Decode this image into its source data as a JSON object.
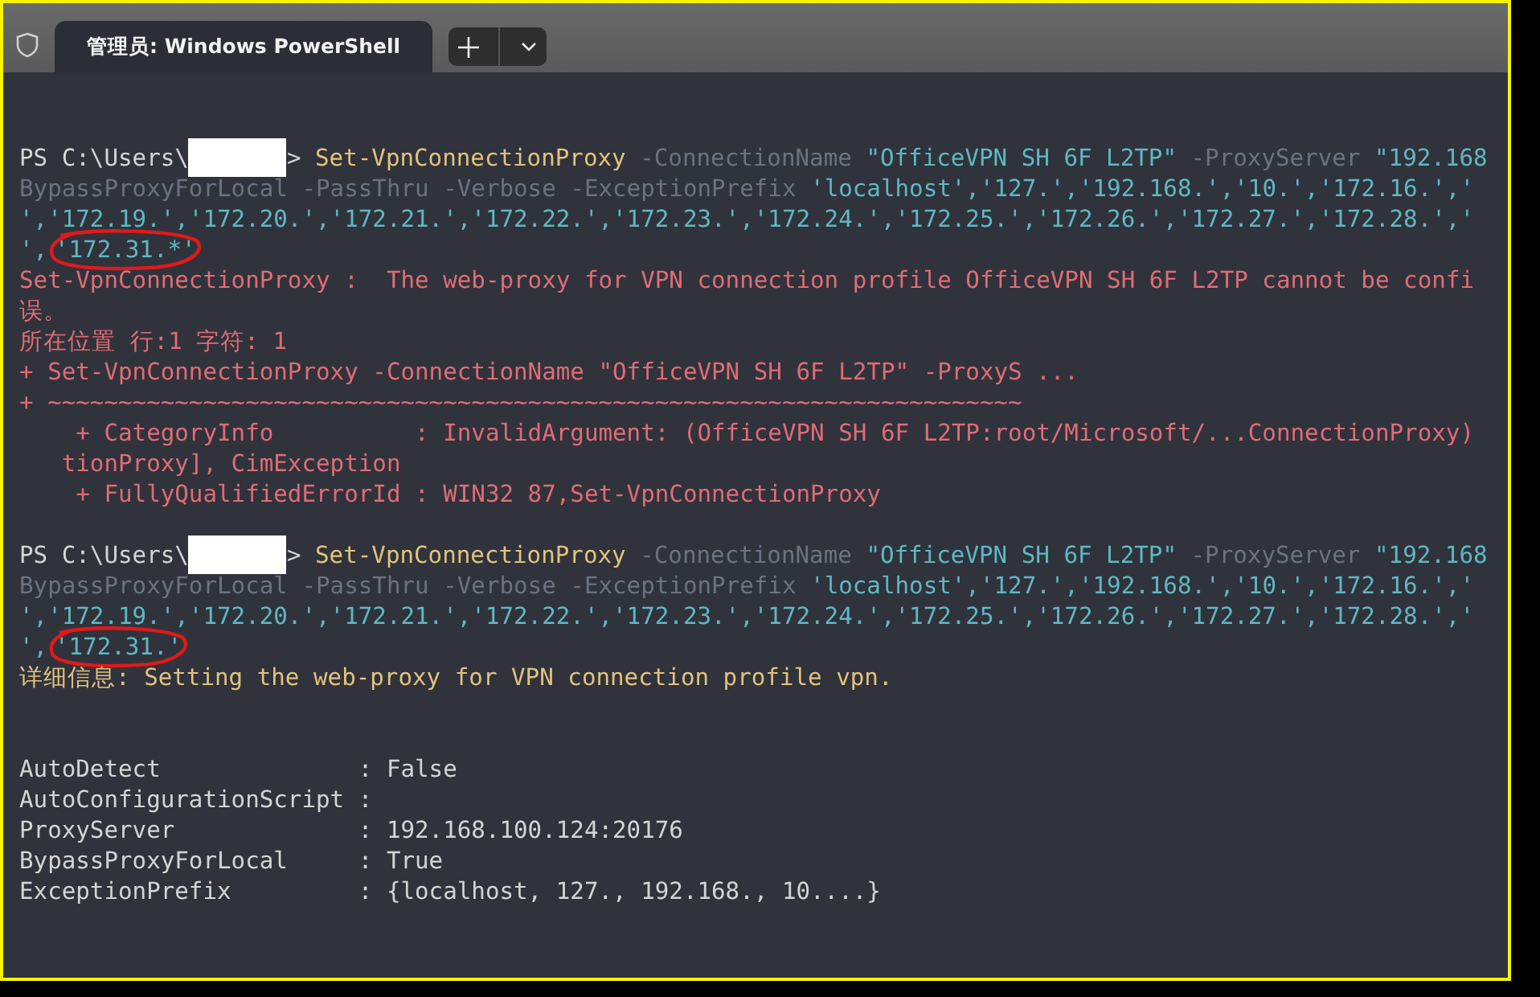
{
  "tabs": [
    {
      "title": "管理员: Windows PowerShell",
      "selected": true
    }
  ],
  "terminal": {
    "lines": [
      {
        "kind": "blank"
      },
      {
        "kind": "prompt",
        "prompt": "PS C:\\Users\\",
        "redacted": true,
        "segments": [
          {
            "text": "> ",
            "kind": "plain"
          },
          {
            "text": "Set-VpnConnectionProxy",
            "kind": "command"
          },
          {
            "text": " -ConnectionName ",
            "kind": "param"
          },
          {
            "text": "\"OfficeVPN SH 6F L2TP\"",
            "kind": "string"
          },
          {
            "text": " -ProxyServer ",
            "kind": "param"
          },
          {
            "text": "\"192.168",
            "kind": "string"
          }
        ]
      },
      {
        "kind": "output",
        "segments": [
          {
            "text": "BypassProxyForLocal -PassThru -Verbose -ExceptionPrefix ",
            "kind": "param"
          },
          {
            "text": "'localhost','127.','192.168.','10.','172.16.','",
            "kind": "string"
          }
        ]
      },
      {
        "kind": "output",
        "segments": [
          {
            "text": "','172.19.','172.20.','172.21.','172.22.','172.23.','172.24.','172.25.','172.26.','172.27.','172.28.','",
            "kind": "string"
          }
        ]
      },
      {
        "kind": "output",
        "segments": [
          {
            "text": "',",
            "kind": "string"
          },
          {
            "text": "'172.31.*'",
            "kind": "string",
            "circled": true
          }
        ]
      },
      {
        "kind": "output",
        "segments": [
          {
            "text": "Set-VpnConnectionProxy :  The web-proxy for VPN connection profile OfficeVPN SH 6F L2TP cannot be confi",
            "kind": "error"
          }
        ]
      },
      {
        "kind": "output",
        "segments": [
          {
            "text": "误。",
            "kind": "error"
          }
        ]
      },
      {
        "kind": "output",
        "segments": [
          {
            "text": "所在位置 行:1 字符: 1",
            "kind": "error"
          }
        ]
      },
      {
        "kind": "output",
        "segments": [
          {
            "text": "+ Set-VpnConnectionProxy -ConnectionName \"OfficeVPN SH 6F L2TP\" -ProxyS ...",
            "kind": "error"
          }
        ]
      },
      {
        "kind": "output",
        "segments": [
          {
            "text": "+ ~~~~~~~~~~~~~~~~~~~~~~~~~~~~~~~~~~~~~~~~~~~~~~~~~~~~~~~~~~~~~~~~~~~~~",
            "kind": "error"
          }
        ]
      },
      {
        "kind": "output",
        "segments": [
          {
            "text": "    + CategoryInfo          : InvalidArgument: (OfficeVPN SH 6F L2TP:root/Microsoft/...ConnectionProxy)",
            "kind": "error"
          }
        ]
      },
      {
        "kind": "output",
        "segments": [
          {
            "text": "   tionProxy], CimException",
            "kind": "error"
          }
        ]
      },
      {
        "kind": "output",
        "segments": [
          {
            "text": "    + FullyQualifiedErrorId : WIN32 87,Set-VpnConnectionProxy",
            "kind": "error"
          }
        ]
      },
      {
        "kind": "blank"
      },
      {
        "kind": "prompt",
        "prompt": "PS C:\\Users\\",
        "redacted": true,
        "segments": [
          {
            "text": "> ",
            "kind": "plain"
          },
          {
            "text": "Set-VpnConnectionProxy",
            "kind": "command"
          },
          {
            "text": " -ConnectionName ",
            "kind": "param"
          },
          {
            "text": "\"OfficeVPN SH 6F L2TP\"",
            "kind": "string"
          },
          {
            "text": " -ProxyServer ",
            "kind": "param"
          },
          {
            "text": "\"192.168",
            "kind": "string"
          }
        ]
      },
      {
        "kind": "output",
        "segments": [
          {
            "text": "BypassProxyForLocal -PassThru -Verbose -ExceptionPrefix ",
            "kind": "param"
          },
          {
            "text": "'localhost','127.','192.168.','10.','172.16.','",
            "kind": "string"
          }
        ]
      },
      {
        "kind": "output",
        "segments": [
          {
            "text": "','172.19.','172.20.','172.21.','172.22.','172.23.','172.24.','172.25.','172.26.','172.27.','172.28.','",
            "kind": "string"
          }
        ]
      },
      {
        "kind": "output",
        "segments": [
          {
            "text": "',",
            "kind": "string"
          },
          {
            "text": "'172.31.'",
            "kind": "string",
            "circled": true
          }
        ]
      },
      {
        "kind": "output",
        "segments": [
          {
            "text": "详细信息: Setting the web-proxy for VPN connection profile vpn.",
            "kind": "verbose"
          }
        ]
      },
      {
        "kind": "blank"
      },
      {
        "kind": "blank"
      },
      {
        "kind": "output",
        "segments": [
          {
            "text": "AutoDetect              : False",
            "kind": "plain"
          }
        ]
      },
      {
        "kind": "output",
        "segments": [
          {
            "text": "AutoConfigurationScript :",
            "kind": "plain"
          }
        ]
      },
      {
        "kind": "output",
        "segments": [
          {
            "text": "ProxyServer             : 192.168.100.124:20176",
            "kind": "plain"
          }
        ]
      },
      {
        "kind": "output",
        "segments": [
          {
            "text": "BypassProxyForLocal     : True",
            "kind": "plain"
          }
        ]
      },
      {
        "kind": "output",
        "segments": [
          {
            "text": "ExceptionPrefix         : {localhost, 127., 192.168., 10....}",
            "kind": "plain"
          }
        ]
      }
    ]
  }
}
